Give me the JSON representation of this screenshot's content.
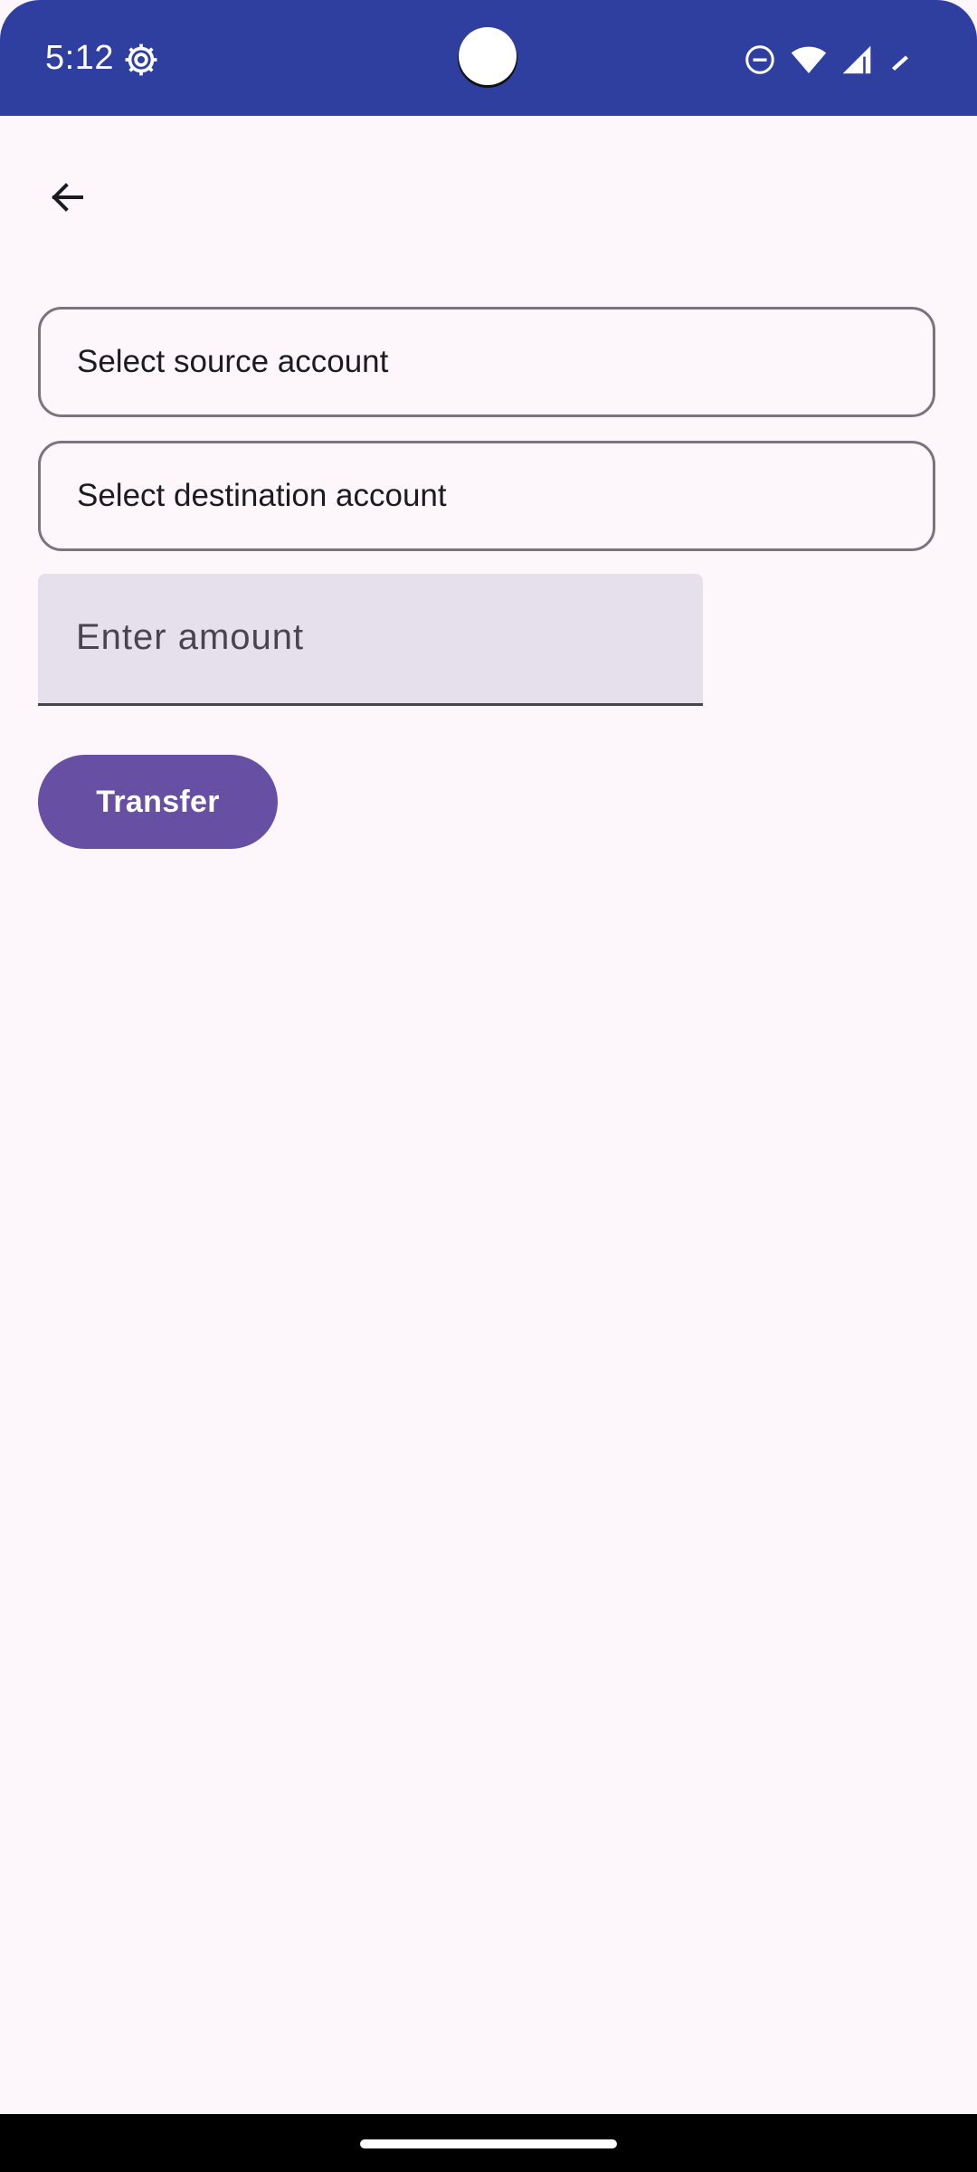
{
  "status_bar": {
    "time": "5:12",
    "background_color": "#2f3f9f",
    "icons": [
      "settings-gear-icon",
      "do-not-disturb-icon",
      "wifi-icon",
      "cell-signal-icon",
      "battery-icon"
    ]
  },
  "app_bar": {
    "back_icon": "arrow-back-icon"
  },
  "form": {
    "source_account": {
      "label": "Select source account"
    },
    "destination_account": {
      "label": "Select destination account"
    },
    "amount": {
      "placeholder": "Enter amount",
      "value": ""
    },
    "transfer_button": {
      "label": "Transfer",
      "color": "#6750a4"
    }
  },
  "theme": {
    "background": "#fdf7fc",
    "outline": "#79747e",
    "field_fill": "#e6e0ec"
  }
}
